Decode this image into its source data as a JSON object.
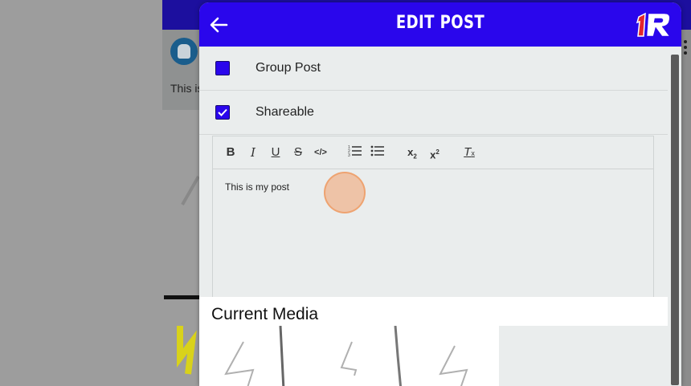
{
  "background": {
    "post_preview_text": "This is"
  },
  "modal": {
    "title": "EDIT POST",
    "logo_text": "1R",
    "options": [
      {
        "label": "Group Post",
        "checked": false
      },
      {
        "label": "Shareable",
        "checked": true
      }
    ],
    "toolbar": [
      "bold",
      "italic",
      "underline",
      "strikethrough",
      "code",
      "ordered-list",
      "bullet-list",
      "subscript",
      "superscript",
      "clear-format"
    ],
    "editor_text": "This is my post",
    "media_heading": "Current Media"
  },
  "colors": {
    "accent": "#2a06ec",
    "panel": "#eaeded"
  }
}
